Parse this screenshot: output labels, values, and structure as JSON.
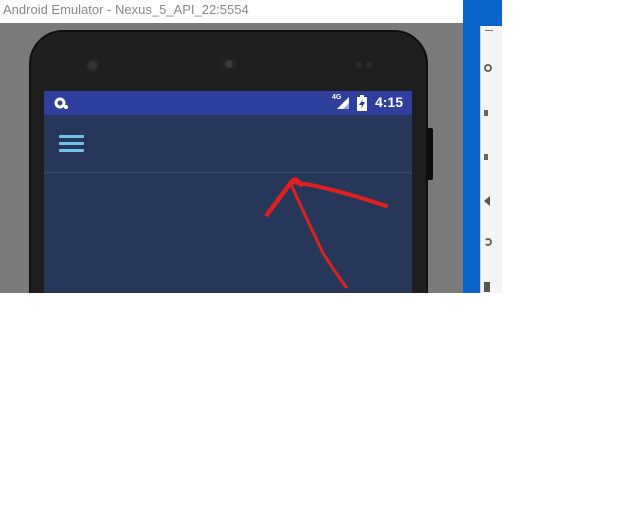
{
  "window": {
    "title": "Android Emulator - Nexus_5_API_22:5554"
  },
  "status_bar": {
    "time": "4:15",
    "network_label": "4G",
    "icons": [
      "notification-icon",
      "signal-icon",
      "battery-charging-icon"
    ]
  },
  "app_bar": {
    "menu_icon": "hamburger-menu-icon"
  },
  "annotation": {
    "icon": "red-arrow-annotation"
  },
  "colors": {
    "status_bar": "#2f3f9e",
    "app_background": "#263759",
    "menu_icon": "#6fc3e6",
    "annotation": "#e02020"
  }
}
